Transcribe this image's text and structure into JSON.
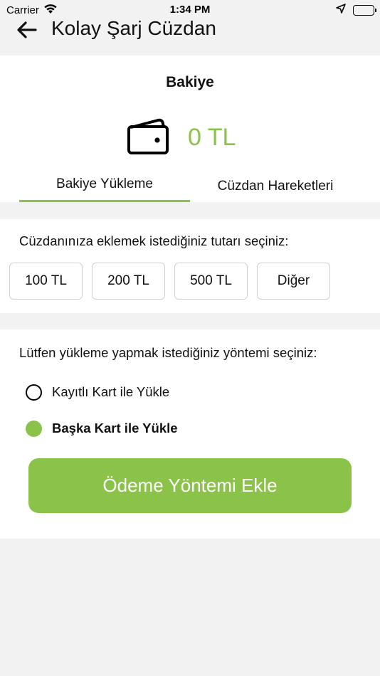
{
  "status_bar": {
    "carrier": "Carrier",
    "time": "1:34 PM"
  },
  "nav": {
    "title": "Kolay Şarj Cüzdan"
  },
  "balance": {
    "label": "Bakiye",
    "value": "0 TL"
  },
  "tabs": [
    {
      "label": "Bakiye Yükleme",
      "active": true
    },
    {
      "label": "Cüzdan Hareketleri",
      "active": false
    }
  ],
  "amount": {
    "prompt": "Cüzdanınıza eklemek istediğiniz tutarı seçiniz:",
    "options": [
      "100 TL",
      "200 TL",
      "500 TL",
      "Diğer"
    ]
  },
  "method": {
    "prompt": "Lütfen yükleme yapmak istediğiniz yöntemi seçiniz:",
    "options": [
      {
        "label": "Kayıtlı Kart ile Yükle",
        "selected": false
      },
      {
        "label": "Başka Kart ile Yükle",
        "selected": true
      }
    ],
    "button_label": "Ödeme Yöntemi Ekle"
  },
  "colors": {
    "accent": "#8bc34a",
    "background": "#f2f2f2",
    "card": "#ffffff"
  },
  "icons": [
    "wifi-icon",
    "location-arrow-icon",
    "battery-icon",
    "back-arrow-icon",
    "wallet-icon"
  ]
}
